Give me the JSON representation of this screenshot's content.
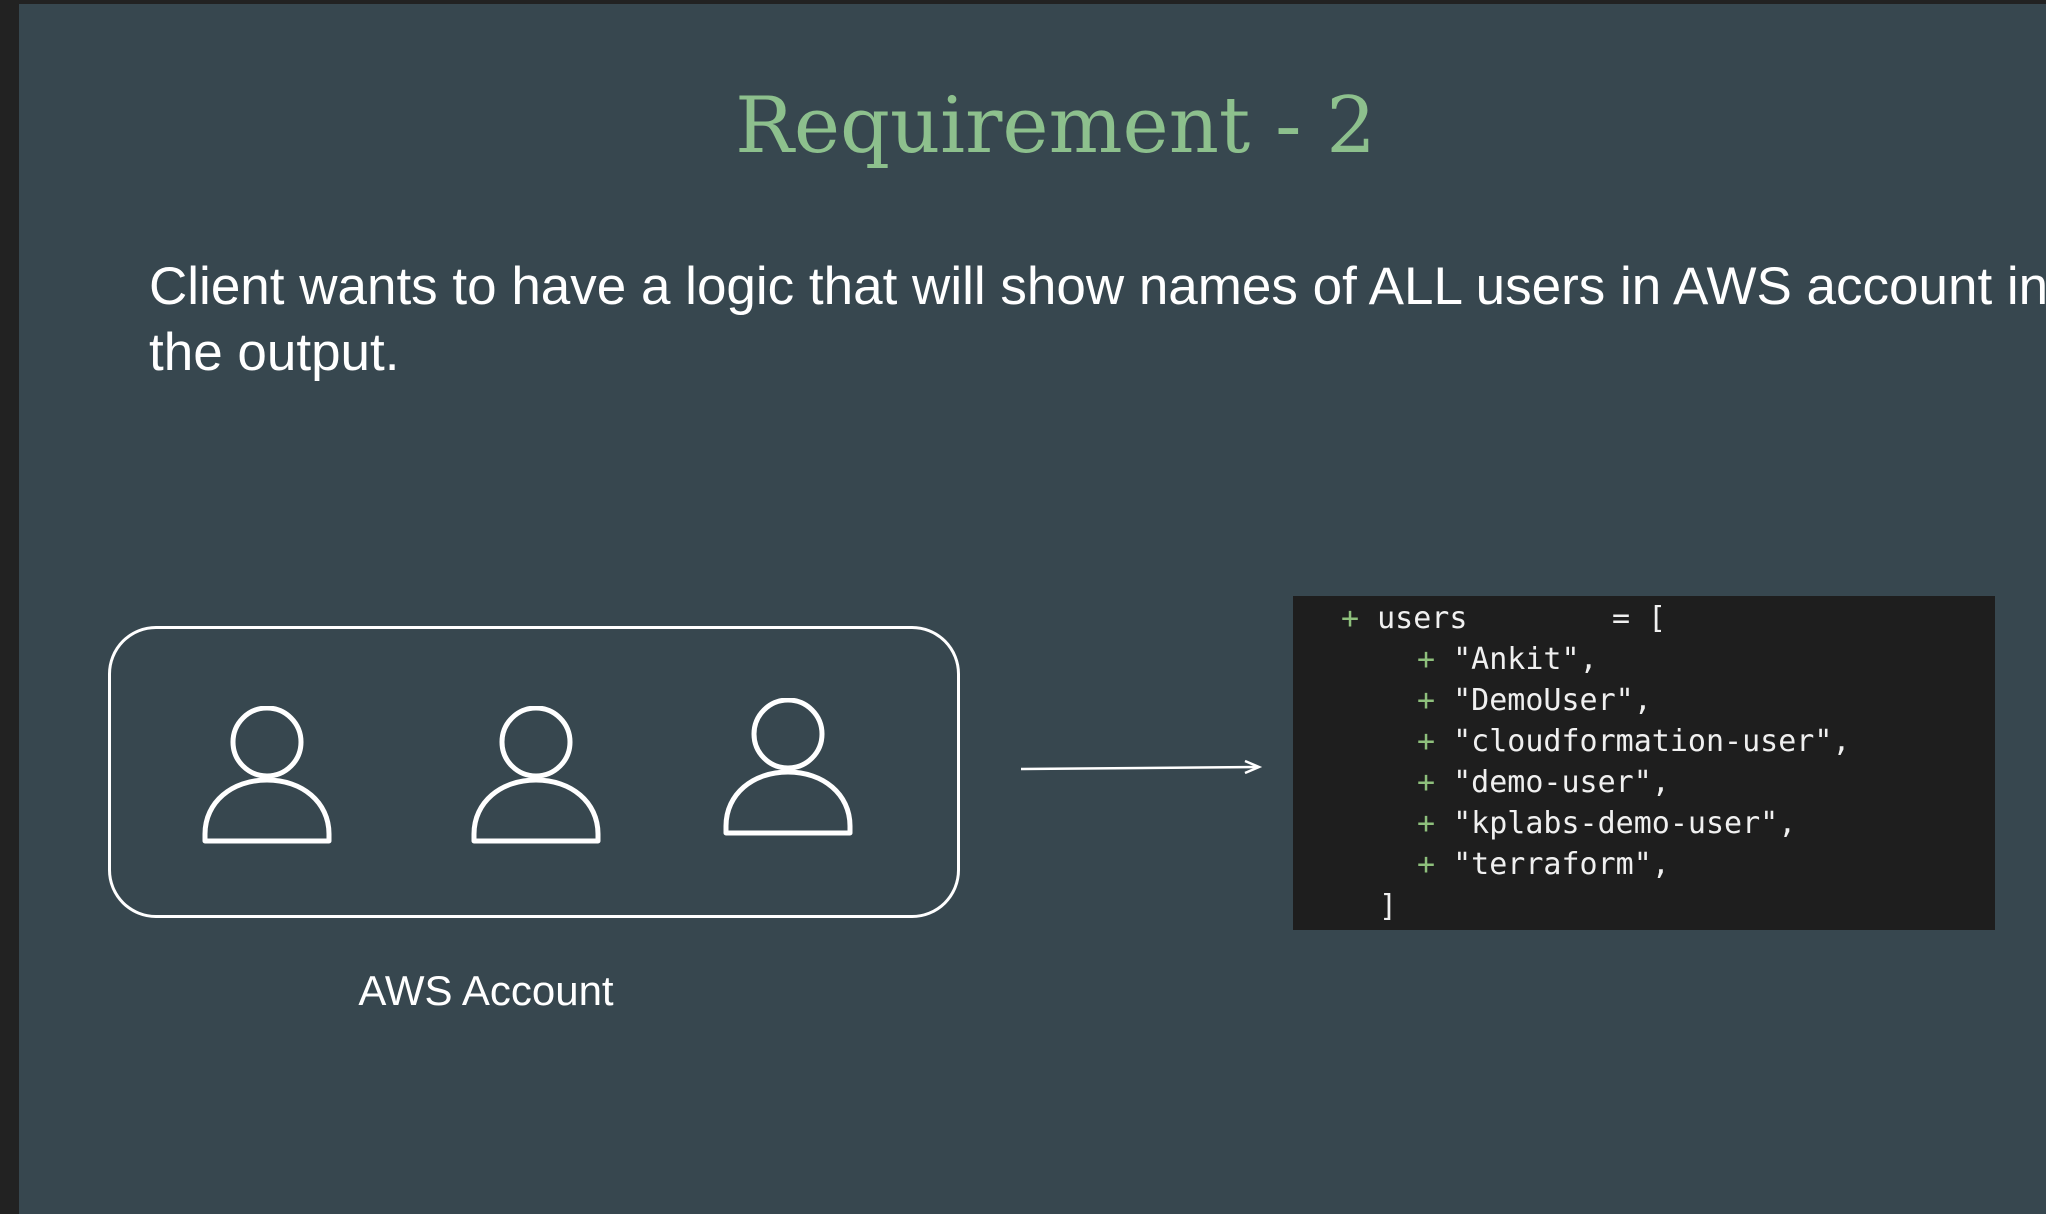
{
  "slide": {
    "title": "Requirement - 2",
    "description": "Client wants to have a logic that will show names of ALL users in AWS account in the output."
  },
  "diagram": {
    "account_label": "AWS Account",
    "user_icon_count": 3
  },
  "code_output": {
    "header": {
      "marker": "+",
      "key": "users",
      "operator": "= ["
    },
    "items": [
      {
        "marker": "+",
        "text": "\"Ankit\","
      },
      {
        "marker": "+",
        "text": "\"DemoUser\","
      },
      {
        "marker": "+",
        "text": "\"cloudformation-user\","
      },
      {
        "marker": "+",
        "text": "\"demo-user\","
      },
      {
        "marker": "+",
        "text": "\"kplabs-demo-user\","
      },
      {
        "marker": "+",
        "text": "\"terraform\","
      }
    ],
    "closing": "]"
  },
  "colors": {
    "slide_background": "#37474f",
    "title": "#8dc08d",
    "code_background": "#1e1e1e",
    "diff_marker": "#8ec07c"
  }
}
